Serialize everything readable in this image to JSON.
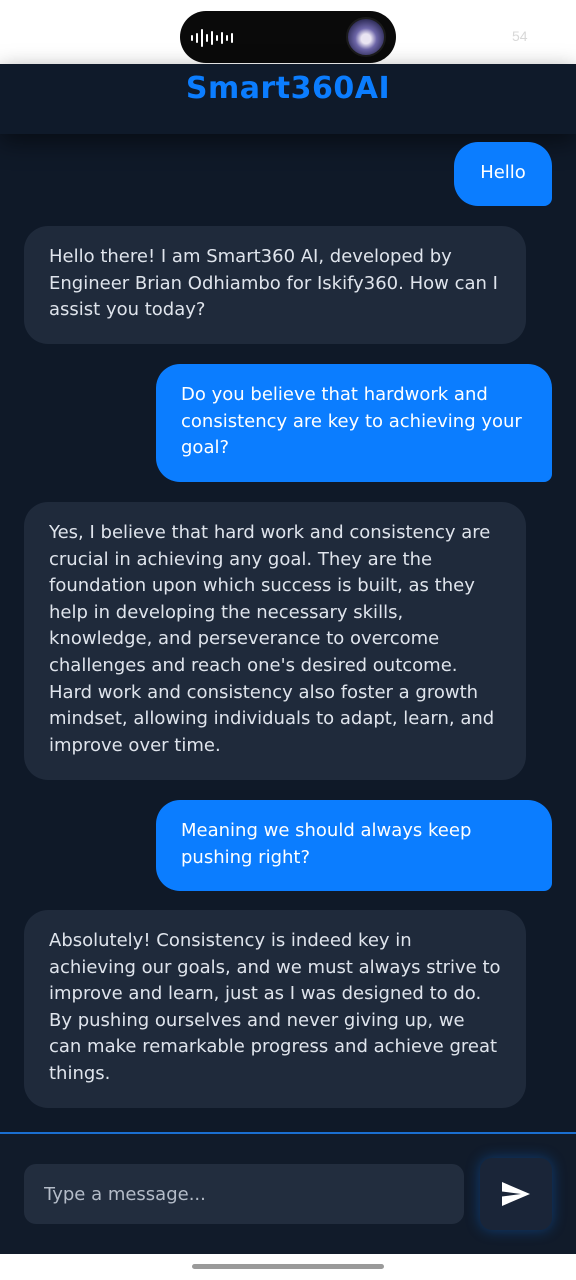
{
  "status_bar": {
    "time": "54"
  },
  "app": {
    "title": "Smart360AI",
    "accent_color": "#0b7dff",
    "background_color": "#0f1928"
  },
  "messages": [
    {
      "role": "user",
      "text": "Hello"
    },
    {
      "role": "bot",
      "text": "Hello there! I am Smart360 AI, developed by Engineer Brian Odhiambo for Iskify360. How can I assist you today?"
    },
    {
      "role": "user",
      "text": "Do you believe that hardwork and consistency are key to achieving your goal?"
    },
    {
      "role": "bot",
      "text": "Yes, I believe that hard work and consistency are crucial in achieving any goal. They are the foundation upon which success is built, as they help in developing the necessary skills, knowledge, and perseverance to overcome challenges and reach one's desired outcome. Hard work and consistency also foster a growth mindset, allowing individuals to adapt, learn, and improve over time."
    },
    {
      "role": "user",
      "text": "Meaning we should always keep pushing right?"
    },
    {
      "role": "bot",
      "text": "Absolutely! Consistency is indeed key in achieving our goals, and we must always strive to improve and learn, just as I was designed to do. By pushing ourselves and never giving up, we can make remarkable progress and achieve great things."
    }
  ],
  "composer": {
    "placeholder": "Type a message...",
    "send_icon": "send-icon"
  }
}
